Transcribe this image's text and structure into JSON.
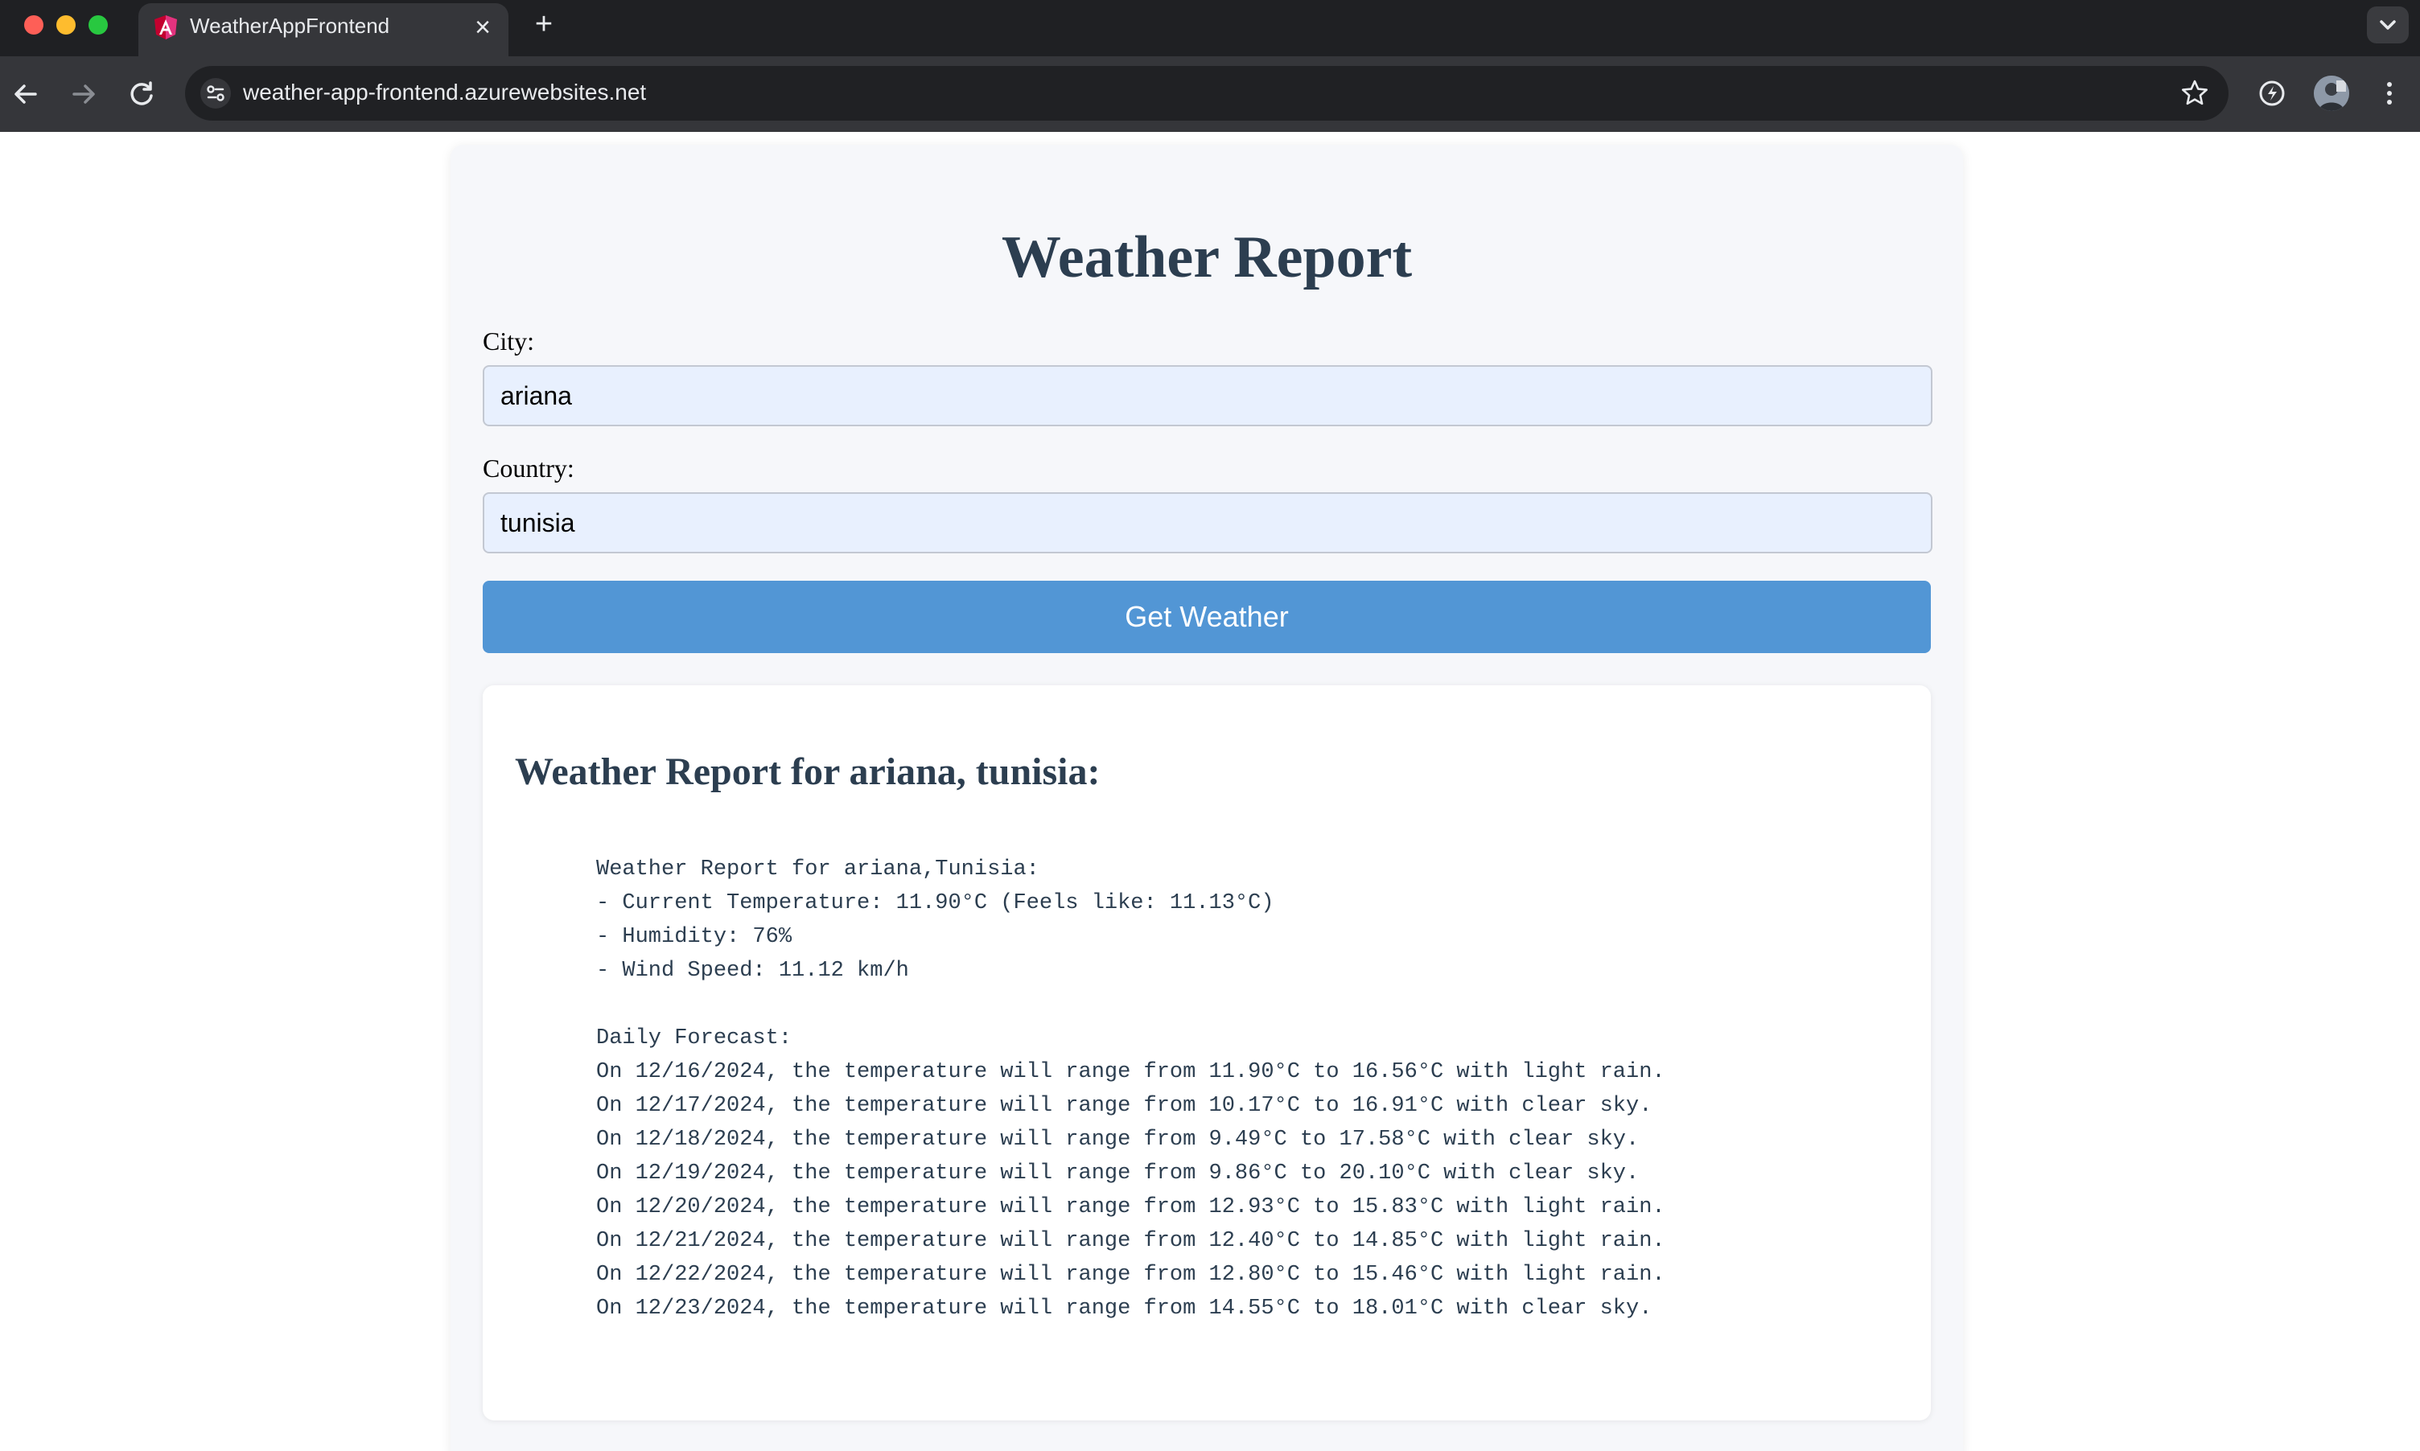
{
  "browser": {
    "tab_title": "WeatherAppFrontend",
    "url": "weather-app-frontend.azurewebsites.net",
    "icons": {
      "close": "close-icon",
      "new_tab": "plus-icon",
      "back": "arrow-left-icon",
      "forward": "arrow-right-icon",
      "reload": "reload-icon",
      "site_info": "tune-icon",
      "bookmark": "star-icon",
      "extension": "extension-icon",
      "menu": "kebab-menu-icon"
    }
  },
  "page": {
    "title": "Weather Report",
    "city_label": "City:",
    "city_value": "ariana",
    "country_label": "Country:",
    "country_value": "tunisia",
    "button_label": "Get Weather",
    "colors": {
      "heading": "#2c3e50",
      "button": "#5296d5",
      "input_bg": "#e8f0fe",
      "card_bg": "#f6f7fa"
    }
  },
  "result": {
    "heading": "Weather Report for ariana, tunisia:",
    "report_title": "Weather Report for ariana,Tunisia:",
    "current": [
      "- Current Temperature: 11.90°C (Feels like: 11.13°C)",
      "- Humidity: 76%",
      "- Wind Speed: 11.12 km/h"
    ],
    "forecast_title": "Daily Forecast:",
    "forecast": [
      "On 12/16/2024, the temperature will range from 11.90°C to 16.56°C with light rain.",
      "On 12/17/2024, the temperature will range from 10.17°C to 16.91°C with clear sky.",
      "On 12/18/2024, the temperature will range from 9.49°C to 17.58°C with clear sky.",
      "On 12/19/2024, the temperature will range from 9.86°C to 20.10°C with clear sky.",
      "On 12/20/2024, the temperature will range from 12.93°C to 15.83°C with light rain.",
      "On 12/21/2024, the temperature will range from 12.40°C to 14.85°C with light rain.",
      "On 12/22/2024, the temperature will range from 12.80°C to 15.46°C with light rain.",
      "On 12/23/2024, the temperature will range from 14.55°C to 18.01°C with clear sky."
    ]
  }
}
